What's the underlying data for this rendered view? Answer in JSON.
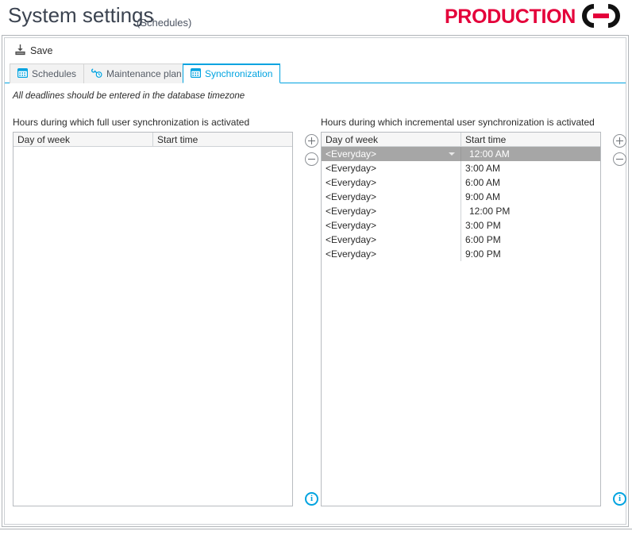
{
  "header": {
    "title": "System settings",
    "subtitle": "(Schedules)",
    "brand_word": "PRODUCTION",
    "brand_icon": "chain-link-icon",
    "brand_color": "#e4003a"
  },
  "toolbar": {
    "save_label": "Save",
    "save_icon": "save-icon"
  },
  "tabs": [
    {
      "label": "Schedules",
      "icon": "calendar-icon",
      "active": false
    },
    {
      "label": "Maintenance plan",
      "icon": "wrench-clock-icon",
      "active": false
    },
    {
      "label": "Synchronization",
      "icon": "calendar-sync-icon",
      "active": true
    }
  ],
  "content": {
    "note": "All deadlines should be entered in the database timezone",
    "accent_color": "#00a3e0",
    "selection_color": "#a6a6a6"
  },
  "panels": {
    "left": {
      "caption": "Hours during which full user synchronization is activated",
      "columns": [
        "Day of week",
        "Start time"
      ],
      "rows": [],
      "add_button": "add-row-button",
      "remove_button": "remove-row-button",
      "info_button": "i"
    },
    "right": {
      "caption": "Hours during which incremental user synchronization is activated",
      "columns": [
        "Day of week",
        "Start time"
      ],
      "rows": [
        {
          "day": "<Everyday>",
          "time": "12:00 AM",
          "selected": true
        },
        {
          "day": "<Everyday>",
          "time": "3:00 AM",
          "selected": false
        },
        {
          "day": "<Everyday>",
          "time": "6:00 AM",
          "selected": false
        },
        {
          "day": "<Everyday>",
          "time": "9:00 AM",
          "selected": false
        },
        {
          "day": "<Everyday>",
          "time": "12:00 PM",
          "selected": false
        },
        {
          "day": "<Everyday>",
          "time": "3:00 PM",
          "selected": false
        },
        {
          "day": "<Everyday>",
          "time": "6:00 PM",
          "selected": false
        },
        {
          "day": "<Everyday>",
          "time": "9:00 PM",
          "selected": false
        }
      ],
      "add_button": "add-row-button",
      "remove_button": "remove-row-button",
      "info_button": "i"
    }
  }
}
